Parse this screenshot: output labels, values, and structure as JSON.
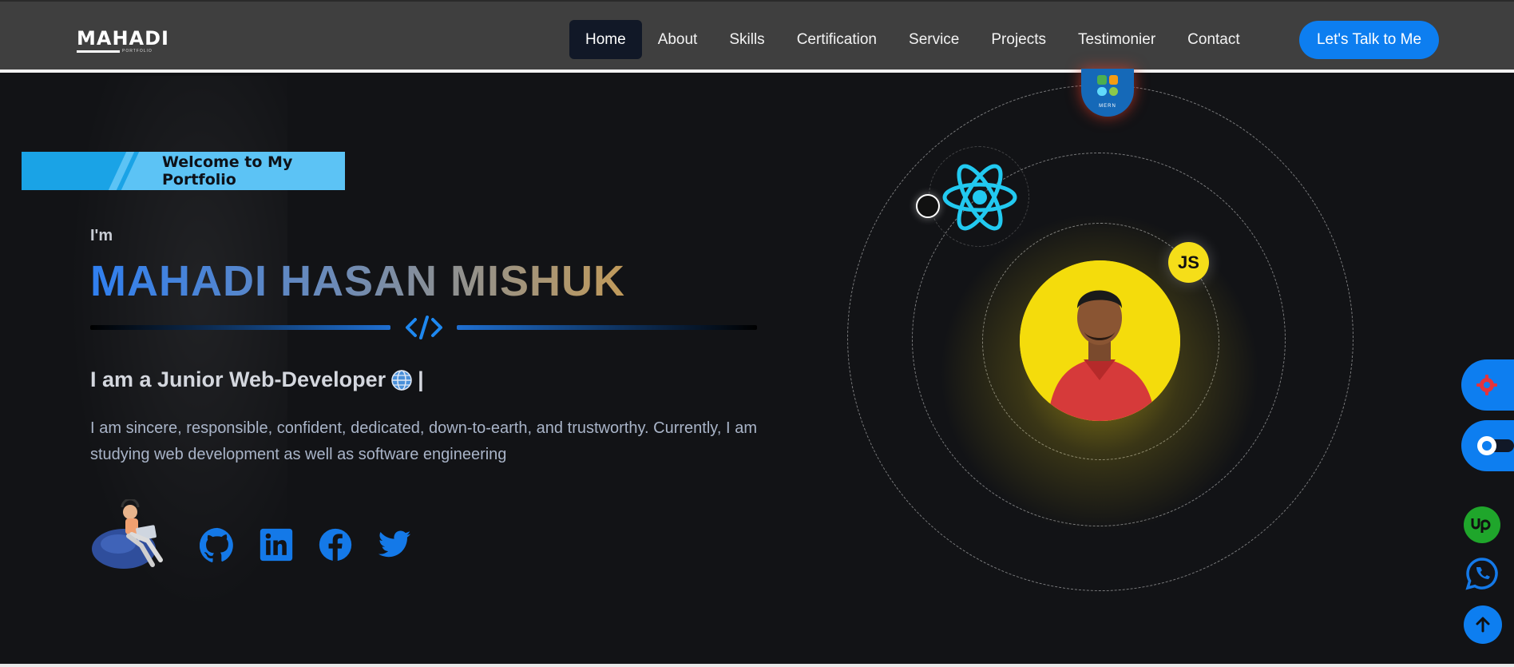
{
  "logo": {
    "title": "MAHADI",
    "subtitle": "PORTFOLIO"
  },
  "nav": {
    "items": [
      "Home",
      "About",
      "Skills",
      "Certification",
      "Service",
      "Projects",
      "Testimonier",
      "Contact"
    ],
    "active": "Home",
    "cta": "Let's Talk to Me"
  },
  "hero": {
    "welcome": "Welcome to My Portfolio",
    "intro": "I'm",
    "name": "MAHADI HASAN MISHUK",
    "role": "I am a Junior Web-Developer",
    "cursor": "|",
    "description": "I am sincere, responsible, confident, dedicated, down-to-earth, and trustworthy. Currently, I am studying web development as well as software engineering"
  },
  "socials": [
    "github-icon",
    "linkedin-icon",
    "facebook-icon",
    "twitter-icon"
  ],
  "orbit_badges": {
    "js": "JS",
    "mern": "MERN"
  },
  "floating": [
    "settings-icon",
    "theme-toggle-icon",
    "upwork-icon",
    "whatsapp-icon",
    "arrow-up-icon"
  ],
  "colors": {
    "accent": "#0d7ef0",
    "navbar": "#3f3f3f",
    "background": "#121316",
    "photo_bg": "#f4dc0c",
    "welcome": "#5cc3f5"
  }
}
